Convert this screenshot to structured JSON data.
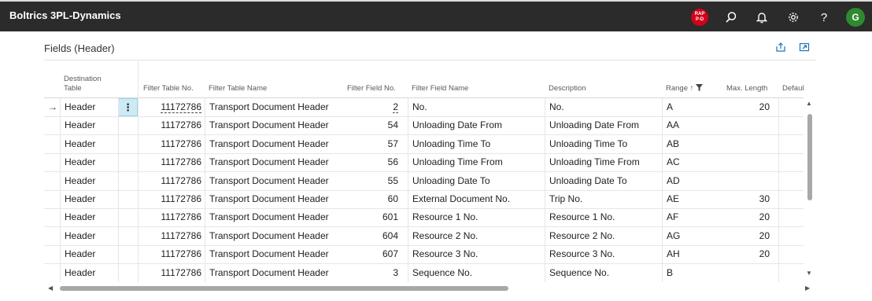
{
  "app": {
    "title": "Boltrics 3PL-Dynamics",
    "badge_line1": "RAP",
    "badge_line2": "P-D",
    "help": "?",
    "avatar": "G"
  },
  "icons": {
    "search": "search-icon",
    "bell": "bell-icon",
    "settings": "gear-icon",
    "share": "share-icon",
    "expand": "expand-icon"
  },
  "panel": {
    "title": "Fields (Header)"
  },
  "columns": {
    "dest_table_1": "Destination",
    "dest_table_2": "Table",
    "filter_table_no": "Filter Table No.",
    "filter_table_name": "Filter Table Name",
    "filter_field_no": "Filter Field No.",
    "filter_field_name": "Filter Field Name",
    "description": "Description",
    "range": "Range",
    "range_sort": "↑",
    "max_length": "Max. Length",
    "default_value": "Default Va"
  },
  "rows": [
    {
      "dest": "Header",
      "tno": "11172786",
      "tname": "Transport Document Header",
      "fno": "2",
      "fname": "No.",
      "desc": "No.",
      "range": "A",
      "maxlen": "20"
    },
    {
      "dest": "Header",
      "tno": "11172786",
      "tname": "Transport Document Header",
      "fno": "54",
      "fname": "Unloading Date From",
      "desc": "Unloading Date From",
      "range": "AA",
      "maxlen": ""
    },
    {
      "dest": "Header",
      "tno": "11172786",
      "tname": "Transport Document Header",
      "fno": "57",
      "fname": "Unloading Time To",
      "desc": "Unloading Time To",
      "range": "AB",
      "maxlen": ""
    },
    {
      "dest": "Header",
      "tno": "11172786",
      "tname": "Transport Document Header",
      "fno": "56",
      "fname": "Unloading Time From",
      "desc": "Unloading Time From",
      "range": "AC",
      "maxlen": ""
    },
    {
      "dest": "Header",
      "tno": "11172786",
      "tname": "Transport Document Header",
      "fno": "55",
      "fname": "Unloading Date To",
      "desc": "Unloading Date To",
      "range": "AD",
      "maxlen": ""
    },
    {
      "dest": "Header",
      "tno": "11172786",
      "tname": "Transport Document Header",
      "fno": "60",
      "fname": "External Document No.",
      "desc": "Trip No.",
      "range": "AE",
      "maxlen": "30"
    },
    {
      "dest": "Header",
      "tno": "11172786",
      "tname": "Transport Document Header",
      "fno": "601",
      "fname": "Resource 1 No.",
      "desc": "Resource 1 No.",
      "range": "AF",
      "maxlen": "20"
    },
    {
      "dest": "Header",
      "tno": "11172786",
      "tname": "Transport Document Header",
      "fno": "604",
      "fname": "Resource 2 No.",
      "desc": "Resource 2 No.",
      "range": "AG",
      "maxlen": "20"
    },
    {
      "dest": "Header",
      "tno": "11172786",
      "tname": "Transport Document Header",
      "fno": "607",
      "fname": "Resource 3 No.",
      "desc": "Resource 3 No.",
      "range": "AH",
      "maxlen": "20"
    },
    {
      "dest": "Header",
      "tno": "11172786",
      "tname": "Transport Document Header",
      "fno": "3",
      "fname": "Sequence No.",
      "desc": "Sequence No.",
      "range": "B",
      "maxlen": ""
    }
  ],
  "grid": {
    "row_arrow": "→",
    "row_menu": "⋮"
  },
  "colors": {
    "topbar": "#2b2b2b",
    "badge": "#d0021b",
    "avatar": "#2f8a2f",
    "accent": "#1a73b8",
    "selected_cell": "#cdeaf5"
  }
}
